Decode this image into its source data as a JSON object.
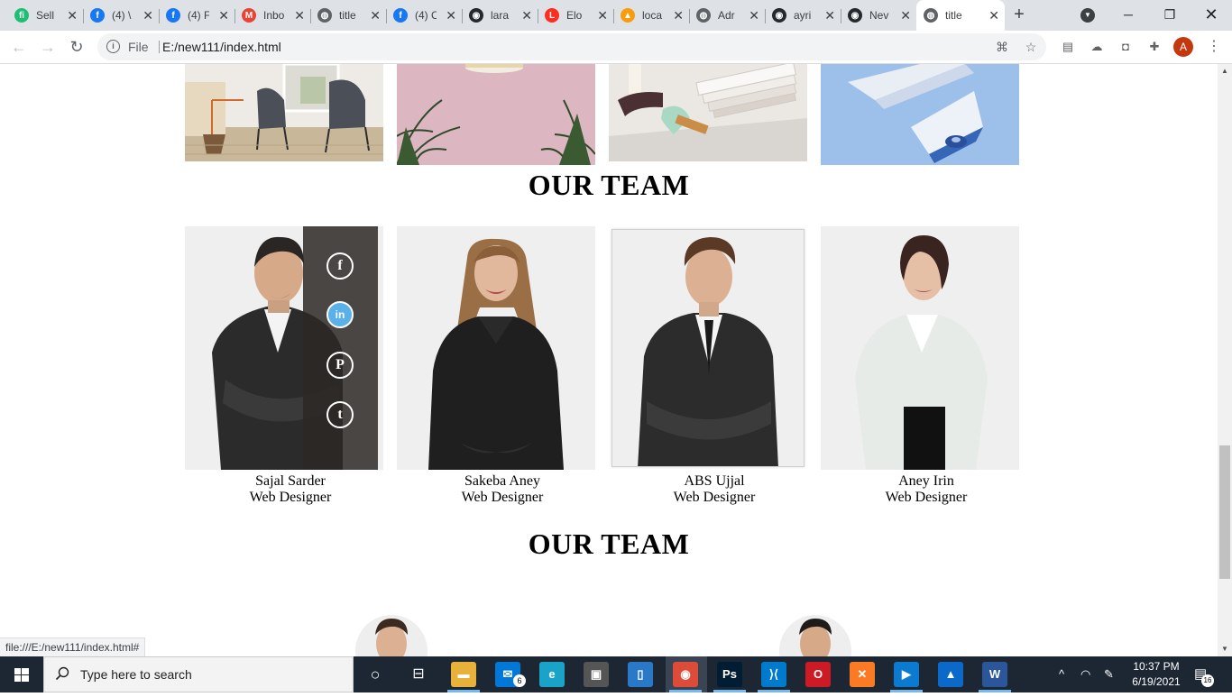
{
  "browser": {
    "tabs": [
      {
        "label": "Sell",
        "favicon": "fiverr-icon",
        "color": "#1dbf73",
        "glyph": "fi"
      },
      {
        "label": "(4) \\",
        "favicon": "facebook-icon",
        "color": "#1877f2",
        "glyph": "f"
      },
      {
        "label": "(4) F",
        "favicon": "facebook-icon",
        "color": "#1877f2",
        "glyph": "f"
      },
      {
        "label": "Inbo",
        "favicon": "gmail-icon",
        "color": "#ea4335",
        "glyph": "M"
      },
      {
        "label": "title",
        "favicon": "globe-icon",
        "color": "#5f6368",
        "glyph": "◍"
      },
      {
        "label": "(4) C",
        "favicon": "facebook-icon",
        "color": "#1877f2",
        "glyph": "f"
      },
      {
        "label": "lara",
        "favicon": "github-icon",
        "color": "#24292e",
        "glyph": "◉"
      },
      {
        "label": "Elo",
        "favicon": "laravel-icon",
        "color": "#ff2d20",
        "glyph": "L"
      },
      {
        "label": "loca",
        "favicon": "phpmyadmin-icon",
        "color": "#f89c0e",
        "glyph": "▲"
      },
      {
        "label": "Adr",
        "favicon": "globe-icon",
        "color": "#5f6368",
        "glyph": "◍"
      },
      {
        "label": "ayri",
        "favicon": "github-icon",
        "color": "#24292e",
        "glyph": "◉"
      },
      {
        "label": "Nev",
        "favicon": "github-icon",
        "color": "#24292e",
        "glyph": "◉"
      },
      {
        "label": "title",
        "favicon": "globe-icon",
        "color": "#5f6368",
        "glyph": "◍",
        "active": true
      }
    ],
    "new_tab": "+",
    "omnibox": {
      "scheme": "File",
      "url": "E:/new111/index.html"
    },
    "profile_initial": "A",
    "status_url": "file:///E:/new111/index.html#"
  },
  "page": {
    "team_title": "OUR TEAM",
    "team_title_2": "OUR TEAM",
    "members": [
      {
        "name": "Sajal Sarder",
        "role": "Web Designer"
      },
      {
        "name": "Sakeba Aney",
        "role": "Web Designer"
      },
      {
        "name": "ABS Ujjal",
        "role": "Web Designer"
      },
      {
        "name": "Aney Irin",
        "role": "Web Designer"
      }
    ],
    "social": {
      "facebook": "f",
      "linkedin": "in",
      "pinterest": "P",
      "twitter": "t"
    }
  },
  "taskbar": {
    "search_placeholder": "Type here to search",
    "mail_badge": "6",
    "time": "10:37 PM",
    "date": "6/19/2021",
    "notification_count": "16",
    "apps": [
      {
        "name": "file-explorer-icon",
        "color": "#e8b13a",
        "glyph": "▬"
      },
      {
        "name": "mail-icon",
        "color": "#0078d7",
        "glyph": "✉"
      },
      {
        "name": "edge-icon",
        "color": "#1aa3c9",
        "glyph": "e"
      },
      {
        "name": "store-icon",
        "color": "#555555",
        "glyph": "▣"
      },
      {
        "name": "app-icon",
        "color": "#2a78c8",
        "glyph": "▯"
      },
      {
        "name": "chrome-icon",
        "color": "#dd4b39",
        "glyph": "◉"
      },
      {
        "name": "photoshop-icon",
        "color": "#001d34",
        "glyph": "Ps"
      },
      {
        "name": "vscode-icon",
        "color": "#007acc",
        "glyph": "⟩⟨"
      },
      {
        "name": "opera-icon",
        "color": "#cc1b24",
        "glyph": "O"
      },
      {
        "name": "xampp-icon",
        "color": "#fb7a24",
        "glyph": "✕"
      },
      {
        "name": "movies-icon",
        "color": "#0a7bd1",
        "glyph": "▶"
      },
      {
        "name": "photos-icon",
        "color": "#0a69c9",
        "glyph": "▲"
      },
      {
        "name": "word-icon",
        "color": "#2b579a",
        "glyph": "W"
      }
    ]
  }
}
